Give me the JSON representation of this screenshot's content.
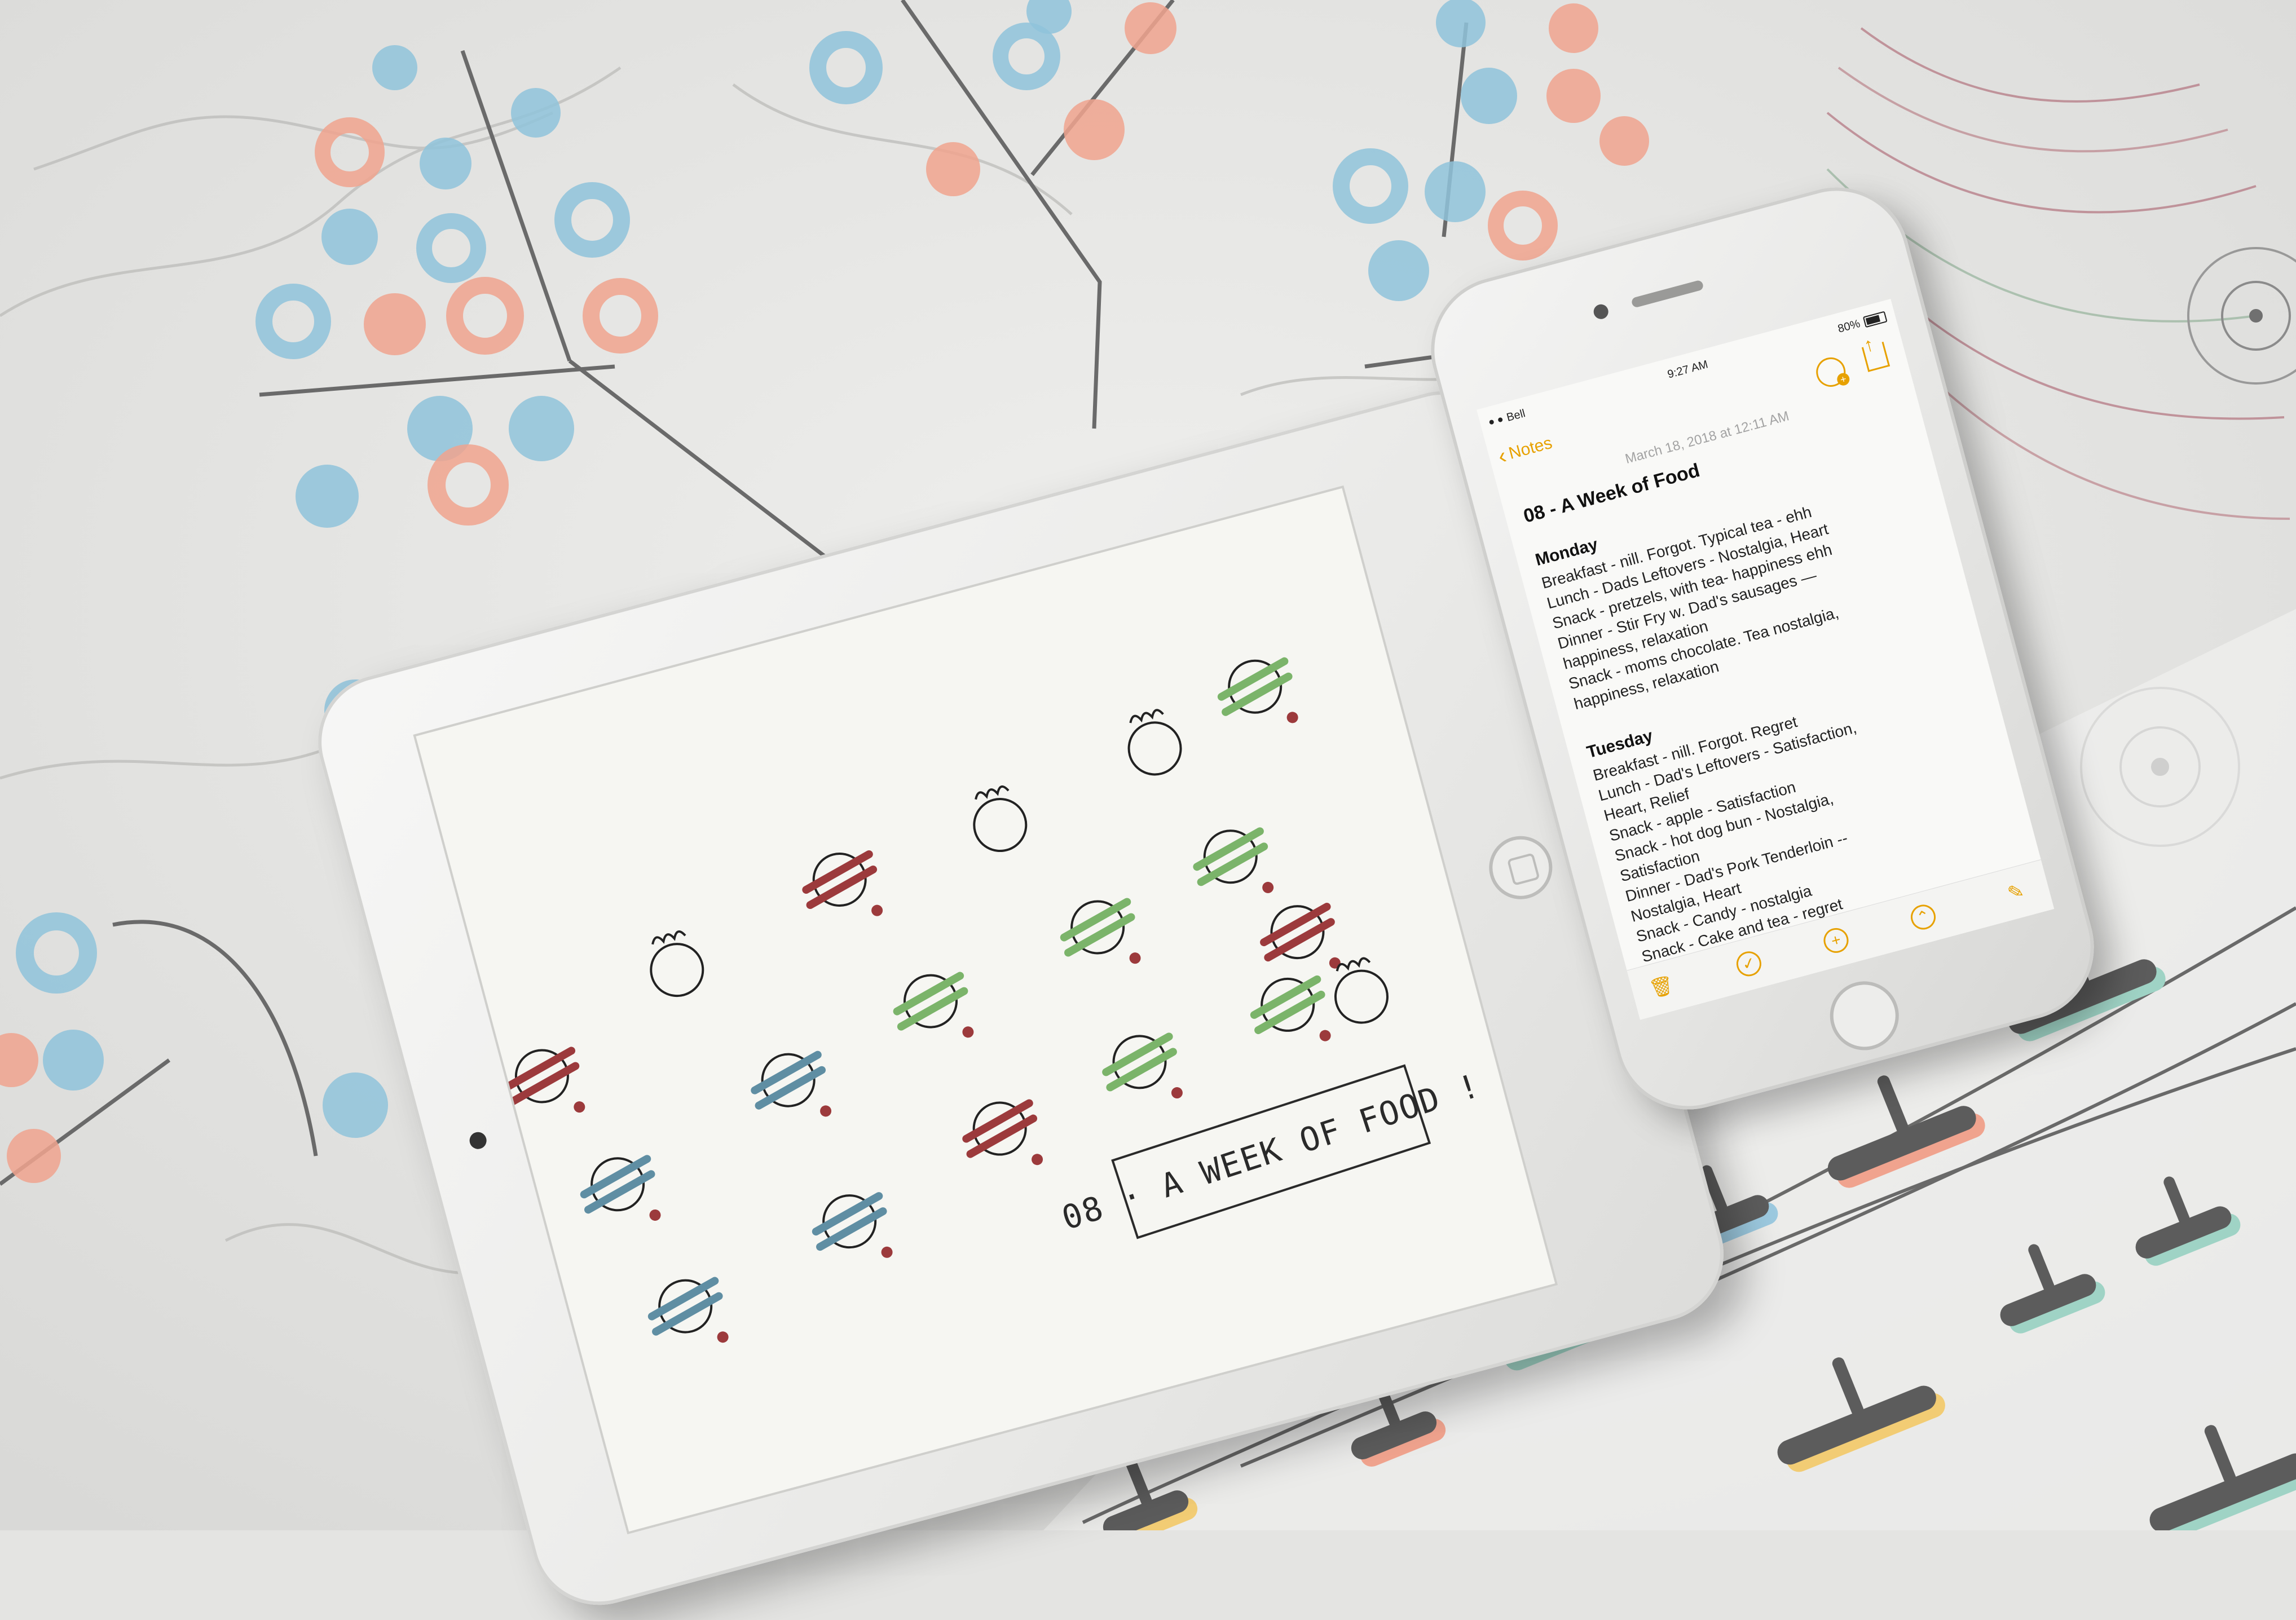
{
  "ipad": {
    "drawing_title": "08 · A WEEK OF FOOD !"
  },
  "iphone": {
    "status": {
      "carrier": "Bell",
      "time": "9:27 AM",
      "battery": "80%"
    },
    "nav": {
      "back_label": "Notes"
    },
    "note": {
      "date": "March 18, 2018 at 12:11 AM",
      "title": "08 - A Week of Food",
      "days": [
        {
          "name": "Monday",
          "lines": [
            "Breakfast - nill. Forgot. Typical tea - ehh",
            "Lunch - Dads Leftovers - Nostalgia, Heart",
            "Snack - pretzels, with tea- happiness ehh",
            "Dinner - Stir Fry w. Dad's sausages —",
            "happiness, relaxation",
            "Snack - moms chocolate. Tea nostalgia,",
            "happiness, relaxation"
          ]
        },
        {
          "name": "Tuesday",
          "lines": [
            "Breakfast - nill. Forgot. Regret",
            "Lunch - Dad's Leftovers - Satisfaction,",
            "Heart, Relief",
            "Snack - apple - Satisfaction",
            "Snack - hot dog bun - Nostalgia,",
            "Satisfaction",
            "Dinner - Dad's Pork Tenderloin --",
            "Nostalgia, Heart",
            "Snack - Candy - nostalgia",
            "Snack - Cake and tea - regret"
          ]
        }
      ]
    },
    "toolbar_icons": [
      "trash-icon",
      "checklist-icon",
      "add-icon",
      "compass-icon",
      "compose-icon"
    ]
  },
  "colors": {
    "marble": "#e4e4e2",
    "blue_dot": "#8fc3da",
    "coral_dot": "#f0a38e",
    "notes_accent": "#e7a100",
    "doodle_red": "#9c3a3c",
    "doodle_green": "#7bb46a",
    "doodle_blue": "#5f8ea3",
    "timeline_gray": "#5c5c5c",
    "timeline_teal": "#9fd3c5",
    "timeline_yellow": "#f2cc74",
    "timeline_blue": "#9cc9df"
  }
}
